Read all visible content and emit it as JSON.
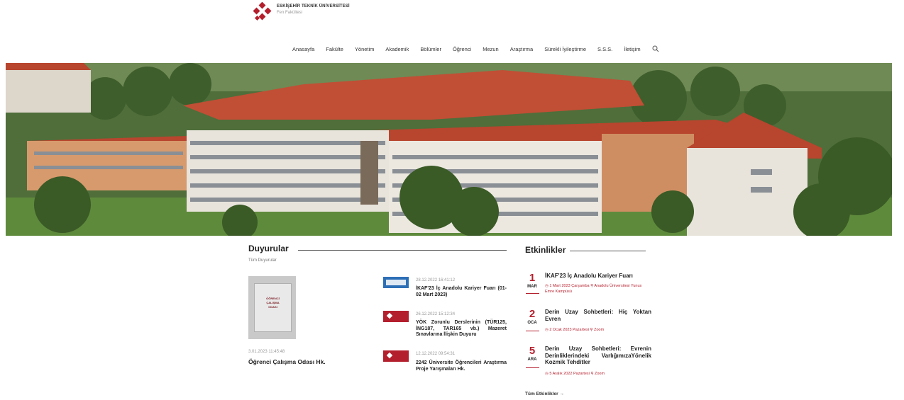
{
  "header": {
    "university": "ESKİŞEHİR TEKNİK ÜNİVERSİTESİ",
    "faculty": "Fen Fakültesi"
  },
  "nav": {
    "items": [
      "Anasayfa",
      "Fakülte",
      "Yönetim",
      "Akademik",
      "Bölümler",
      "Öğrenci",
      "Mezun",
      "Araştırma",
      "Sürekli İyileştirme",
      "S.S.S.",
      "İletişim"
    ],
    "search_icon": "search-icon"
  },
  "announcements": {
    "title": "Duyurular",
    "all_link": "Tüm Duyurular",
    "featured": {
      "poster_lines": [
        "ÖĞRENCİ",
        "ÇALIŞMA",
        "ODASI"
      ],
      "date": "3.01.2023 11:45:48",
      "title": "Öğrenci Çalışma Odası Hk."
    },
    "items": [
      {
        "date": "28.12.2022 16:41:12",
        "title": "İKAF'23 İç Anadolu Kariyer Fuarı (01-02 Mart 2023)"
      },
      {
        "date": "26.12.2022 15:12:34",
        "title": "YÖK Zorunlu Derslerinin (TÜR125, İNG187, TAR165 vb.) Mazeret Sınavlarına İlişkin Duyuru"
      },
      {
        "date": "12.12.2022 09:54:31",
        "title": "2242 Üniversite Öğrencileri Araştırma Proje Yarışmaları Hk."
      }
    ]
  },
  "events": {
    "title": "Etkinlikler",
    "all_link": "Tüm Etkinlikler →",
    "items": [
      {
        "day": "1",
        "month": "MAR",
        "title": "İKAF'23 İç Anadolu Kariyer Fuarı",
        "time": "1 Mart 2023 Çarşamba",
        "place": "Anadolu Üniversitesi Yunus Emre Kampüsü"
      },
      {
        "day": "2",
        "month": "OCA",
        "title": "Derin Uzay Sohbetleri: Hiç Yoktan Evren",
        "time": "2 Ocak 2023 Pazartesi",
        "place": "Zoom"
      },
      {
        "day": "5",
        "month": "ARA",
        "title": "Derin Uzay Sohbetleri: Evrenin Derinliklerindeki VarlığımızaYönelik Kozmik Tehditler",
        "time": "5 Aralık 2022 Pazartesi",
        "place": "Zoom"
      }
    ]
  },
  "colors": {
    "accent": "#b41f2d",
    "roof": "#b8452e",
    "wall": "#e8e4dc",
    "grass": "#5e8a3c"
  }
}
